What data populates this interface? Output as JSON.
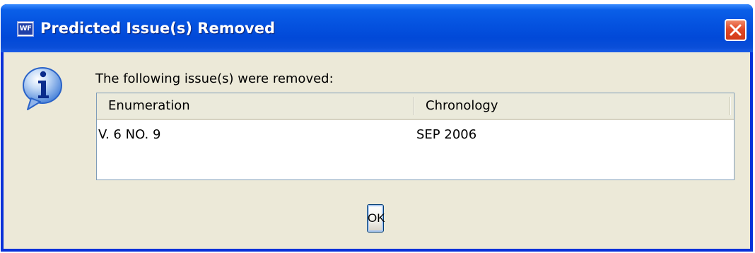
{
  "window": {
    "title": "Predicted Issue(s) Removed",
    "app_icon_text": "WF",
    "close_button_icon": "close-icon"
  },
  "dialog": {
    "icon": "info-icon",
    "message": "The following issue(s) were removed:",
    "table": {
      "columns": [
        "Enumeration",
        "Chronology"
      ],
      "rows": [
        [
          "V. 6 NO. 9",
          "SEP 2006"
        ]
      ]
    },
    "ok_label": "OK"
  },
  "colors": {
    "titlebar": "#0553e0",
    "client_background": "#ece9d8",
    "close_button": "#e24a28",
    "info_icon": "#2a63c8"
  }
}
